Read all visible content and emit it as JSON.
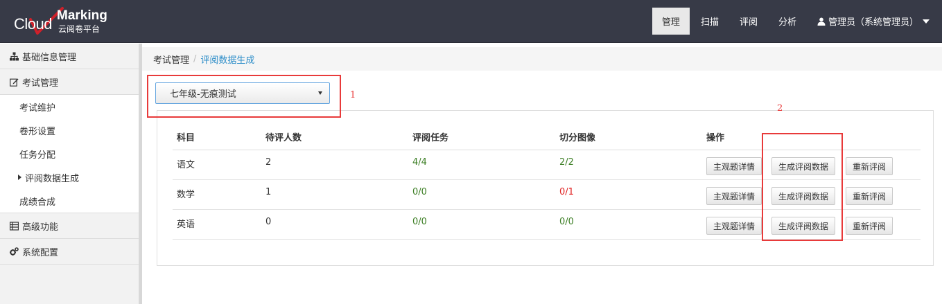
{
  "header": {
    "logo": {
      "word1": "Cloud",
      "word2": "Marking",
      "subtitle": "云阅卷平台"
    },
    "nav": [
      {
        "label": "管理",
        "active": true
      },
      {
        "label": "扫描",
        "active": false
      },
      {
        "label": "评阅",
        "active": false
      },
      {
        "label": "分析",
        "active": false
      }
    ],
    "user": {
      "label": "管理员（系统管理员）",
      "icon": "user-icon"
    }
  },
  "sidebar": {
    "groups": [
      {
        "label": "基础信息管理",
        "icon": "sitemap-icon"
      },
      {
        "label": "考试管理",
        "icon": "edit-icon",
        "items": [
          {
            "label": "考试维护"
          },
          {
            "label": "卷形设置"
          },
          {
            "label": "任务分配"
          },
          {
            "label": "评阅数据生成",
            "active": true
          },
          {
            "label": "成绩合成"
          }
        ]
      },
      {
        "label": "高级功能",
        "icon": "list-icon"
      },
      {
        "label": "系统配置",
        "icon": "gears-icon"
      }
    ]
  },
  "breadcrumb": {
    "parent": "考试管理",
    "separator": "/",
    "current": "评阅数据生成"
  },
  "exam_select": {
    "value": "七年级-无痕测试"
  },
  "table": {
    "headers": [
      "科目",
      "待评人数",
      "评阅任务",
      "切分图像",
      "操作"
    ],
    "rows": [
      {
        "subject": "语文",
        "pending": "2",
        "tasks": "4/4",
        "images": "2/2"
      },
      {
        "subject": "数学",
        "pending": "1",
        "tasks": "0/0",
        "images": "0/1"
      },
      {
        "subject": "英语",
        "pending": "0",
        "tasks": "0/0",
        "images": "0/0"
      }
    ],
    "actions": {
      "detail": "主观题详情",
      "generate": "生成评阅数据",
      "review": "重新评阅"
    }
  },
  "annotations": {
    "label1": "1",
    "label2": "2"
  },
  "colors": {
    "header_bg": "#373a47",
    "annotation": "#e83a3a",
    "ok": "#3a7d22",
    "error": "#e02020",
    "link": "#2a8cc8"
  }
}
